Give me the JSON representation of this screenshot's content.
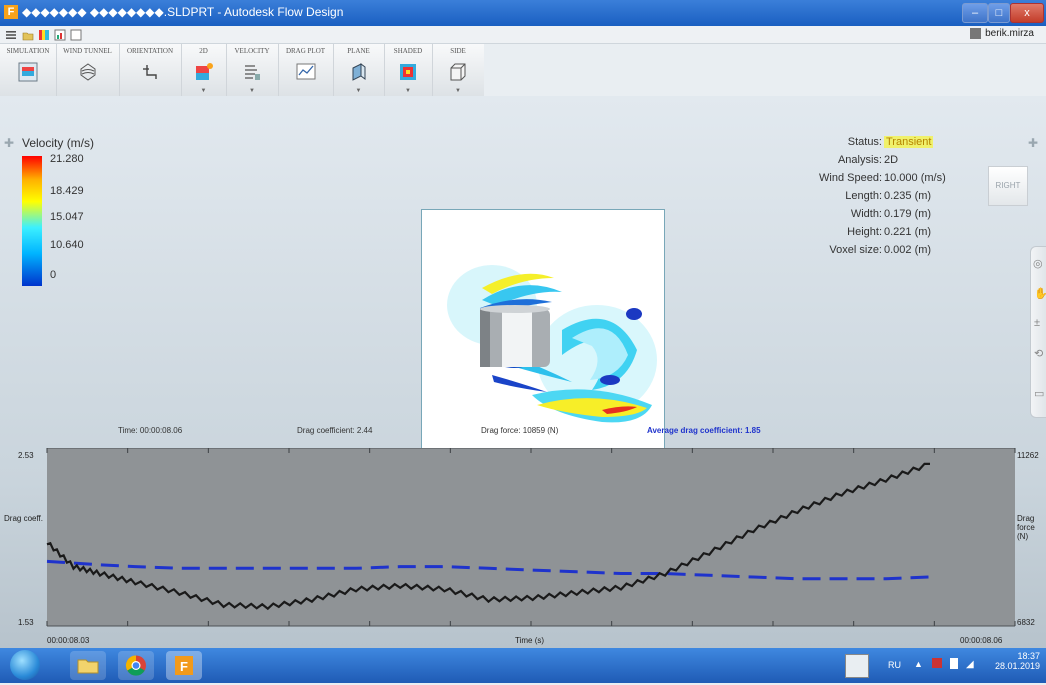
{
  "window": {
    "title": "◆◆◆◆◆◆◆ ◆◆◆◆◆◆◆◆.SLDPRT - Autodesk Flow Design",
    "app_icon_letter": "F",
    "minimize": "–",
    "maximize": "□",
    "close": "x"
  },
  "user": {
    "name": "berik.mirza"
  },
  "ribbon": {
    "buttons": [
      {
        "label": "SIMULATION",
        "icon": "simulation-icon"
      },
      {
        "label": "WIND TUNNEL",
        "icon": "wind-tunnel-icon"
      },
      {
        "label": "ORIENTATION",
        "icon": "orientation-icon"
      },
      {
        "label": "2D",
        "icon": "2d-icon"
      },
      {
        "label": "VELOCITY",
        "icon": "velocity-icon"
      },
      {
        "label": "DRAG PLOT",
        "icon": "drag-plot-icon"
      },
      {
        "label": "PLANE",
        "icon": "plane-icon"
      },
      {
        "label": "SHADED",
        "icon": "shaded-icon"
      },
      {
        "label": "SIDE",
        "icon": "side-icon"
      }
    ]
  },
  "view_cube": {
    "label": "RIGHT"
  },
  "legend": {
    "title": "Velocity (m/s)",
    "ticks": [
      "21.280",
      "18.429",
      "15.047",
      "10.640",
      "0"
    ]
  },
  "status": {
    "rows": [
      {
        "key": "Status:",
        "value": "Transient"
      },
      {
        "key": "Analysis:",
        "value": "2D"
      },
      {
        "key": "Wind Speed:",
        "value": "10.000 (m/s)"
      },
      {
        "key": "Length:",
        "value": "0.235 (m)"
      },
      {
        "key": "Width:",
        "value": "0.179 (m)"
      },
      {
        "key": "Height:",
        "value": "0.221 (m)"
      },
      {
        "key": "Voxel size:",
        "value": "0.002 (m)"
      }
    ]
  },
  "stats": {
    "time": "Time: 00:00:08.06",
    "drag_coefficient": "Drag coefficient: 2.44",
    "drag_force": "Drag force: 10859 (N)",
    "avg_drag_coefficient": "Average drag coefficient: 1.85"
  },
  "chart_data": {
    "type": "line",
    "xlabel": "Time (s)",
    "x_start_label": "00:00:08.03",
    "x_end_label": "00:00:08.06",
    "y_left_label": "Drag coeff.",
    "y_left_range": [
      1.53,
      2.53
    ],
    "y_left_ticks": [
      "2.53",
      "1.53"
    ],
    "y_right_label": "Drag force (N)",
    "y_right_range": [
      6832,
      11262
    ],
    "y_right_ticks": [
      "11262",
      "6832"
    ],
    "x": [
      0.0,
      0.03,
      0.06,
      0.1,
      0.15,
      0.2,
      0.25,
      0.3,
      0.35,
      0.4,
      0.45,
      0.5,
      0.55,
      0.6,
      0.65,
      0.7,
      0.75,
      0.8,
      0.85,
      0.9,
      0.95,
      1.0
    ],
    "series": [
      {
        "name": "Drag coefficient",
        "color": "#1a1a1a",
        "style": "solid",
        "values": [
          2.0,
          1.86,
          1.82,
          1.77,
          1.71,
          1.64,
          1.63,
          1.67,
          1.73,
          1.75,
          1.73,
          1.67,
          1.68,
          1.71,
          1.74,
          1.82,
          1.94,
          2.07,
          2.18,
          2.28,
          2.36,
          2.45
        ]
      },
      {
        "name": "Average drag coefficient",
        "color": "#1f33cc",
        "style": "dashed",
        "values": [
          1.89,
          1.88,
          1.87,
          1.86,
          1.85,
          1.85,
          1.85,
          1.85,
          1.85,
          1.86,
          1.86,
          1.85,
          1.84,
          1.83,
          1.82,
          1.82,
          1.81,
          1.8,
          1.79,
          1.79,
          1.79,
          1.8
        ]
      }
    ]
  },
  "taskbar": {
    "items": [
      "start-orb-icon",
      "file-explorer-icon",
      "chrome-icon",
      "flow-design-icon"
    ],
    "language": "RU",
    "time": "18:37",
    "date": "28.01.2019"
  },
  "colors": {
    "titlebar": "#1a5fc1",
    "avg_line": "#1f33cc",
    "drag_line": "#1a1a1a",
    "plot_bg": "#8f9396",
    "status_highlight": "#f0f16b"
  }
}
